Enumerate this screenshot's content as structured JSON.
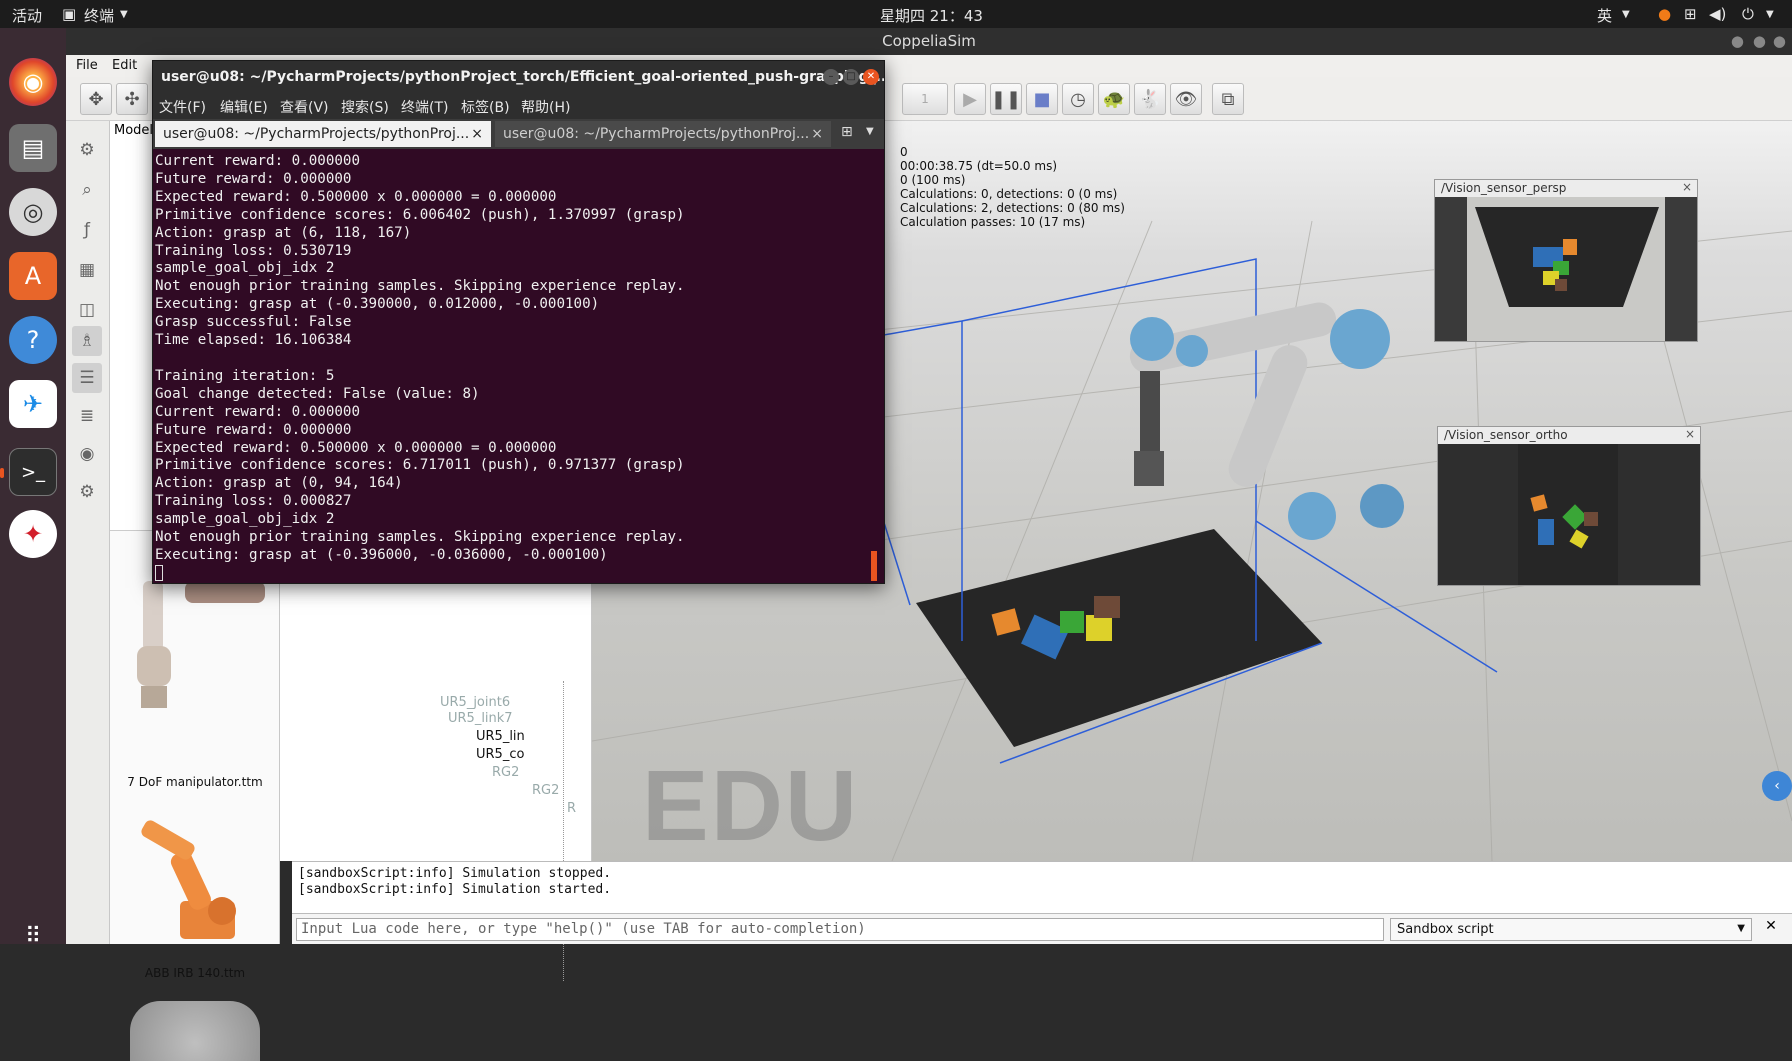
{
  "topbar": {
    "activities": "活动",
    "app_menu": "终端",
    "clock": "星期四 21：43",
    "input_method": "英"
  },
  "dock": {
    "items": [
      "firefox-icon",
      "files-icon",
      "rhythmbox-icon",
      "software-center-icon",
      "help-icon",
      "feishu-icon",
      "terminal-icon",
      "bilibili-icon",
      "show-apps-icon"
    ]
  },
  "coppeliasim": {
    "window_title": "CoppeliaSim",
    "menu": [
      "File",
      "Edit"
    ],
    "toolbar_combo": "1",
    "model_browser_header": "Model",
    "models": [
      "7 DoF manipulator.ttm",
      "ABB IRB 140.ttm"
    ],
    "scene_tree": [
      {
        "label": "UR5_joint6"
      },
      {
        "label": "UR5_link7"
      },
      {
        "label": "UR5_lin"
      },
      {
        "label": "UR5_co"
      },
      {
        "label": "RG2"
      },
      {
        "label": "RG2"
      },
      {
        "label": "R"
      }
    ],
    "sim_info": [
      "0",
      "00:00:38.75 (dt=50.0 ms)",
      "0 (100 ms)",
      "Calculations: 0, detections: 0 (0 ms)",
      "Calculations: 2, detections: 0 (80 ms)",
      "Calculation passes: 10 (17 ms)"
    ],
    "vision_sensors": [
      {
        "title": "/Vision_sensor_persp"
      },
      {
        "title": "/Vision_sensor_ortho"
      }
    ],
    "watermark": "EDU",
    "console_lines": [
      "[sandboxScript:info] Simulation stopped.",
      "[sandboxScript:info] Simulation started."
    ],
    "lua_placeholder": "Input Lua code here, or type \"help()\" (use TAB for auto-completion)",
    "script_select": "Sandbox script"
  },
  "terminal": {
    "title": "user@u08: ~/PycharmProjects/pythonProject_torch/Efficient_goal-oriented_push-grasping_...",
    "menu": [
      "文件(F)",
      "编辑(E)",
      "查看(V)",
      "搜索(S)",
      "终端(T)",
      "标签(B)",
      "帮助(H)"
    ],
    "tabs": [
      "user@u08: ~/PycharmProjects/pythonProj...",
      "user@u08: ~/PycharmProjects/pythonProj..."
    ],
    "lines": [
      "Current reward: 0.000000",
      "Future reward: 0.000000",
      "Expected reward: 0.500000 x 0.000000 = 0.000000",
      "Primitive confidence scores: 6.006402 (push), 1.370997 (grasp)",
      "Action: grasp at (6, 118, 167)",
      "Training loss: 0.530719",
      "sample_goal_obj_idx 2",
      "Not enough prior training samples. Skipping experience replay.",
      "Executing: grasp at (-0.390000, 0.012000, -0.000100)",
      "Grasp successful: False",
      "Time elapsed: 16.106384",
      "",
      "Training iteration: 5",
      "Goal change detected: False (value: 8)",
      "Current reward: 0.000000",
      "Future reward: 0.000000",
      "Expected reward: 0.500000 x 0.000000 = 0.000000",
      "Primitive confidence scores: 6.717011 (push), 0.971377 (grasp)",
      "Action: grasp at (0, 94, 164)",
      "Training loss: 0.000827",
      "sample_goal_obj_idx 2",
      "Not enough prior training samples. Skipping experience replay.",
      "Executing: grasp at (-0.396000, -0.036000, -0.000100)"
    ]
  }
}
